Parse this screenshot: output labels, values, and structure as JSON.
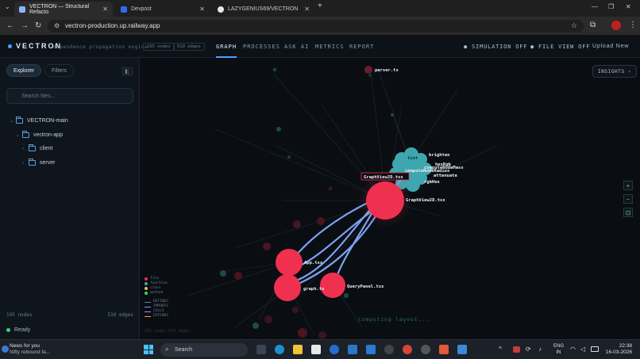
{
  "browser": {
    "tabs": [
      {
        "label": "VECTRON — Structural Refacto",
        "color": "#8ab4f8",
        "active": true
      },
      {
        "label": "Devpost",
        "color": "#2c6bed",
        "active": false
      },
      {
        "label": "LAZYGENIUS69/VECTRON",
        "color": "#e8e8e8",
        "active": false
      }
    ],
    "new_tab": "+",
    "url": "vectron-production.up.railway.app"
  },
  "header": {
    "brand": "VECTRON",
    "tagline": "dependence propagation engine",
    "nodes_pill": "195 nodes",
    "edges_pill": "510 edges",
    "tabs": [
      "GRAPH",
      "PROCESSES",
      "ASK AI",
      "METRICS",
      "REPORT"
    ],
    "active_tab": "GRAPH",
    "simulation": "SIMULATION OFF",
    "file_view": "FILE VIEW OFF",
    "upload": "Upload New"
  },
  "sidebar": {
    "tabs": [
      "Explorer",
      "Filters"
    ],
    "search_placeholder": "Search files...",
    "tree": [
      {
        "label": "VECTRON-main",
        "depth": 0,
        "expanded": true
      },
      {
        "label": "vectron-app",
        "depth": 1,
        "expanded": true
      },
      {
        "label": "client",
        "depth": 2,
        "expanded": false
      },
      {
        "label": "server",
        "depth": 2,
        "expanded": false
      }
    ],
    "node_count": "195 nodes",
    "edge_count": "510 edges",
    "status": "Ready"
  },
  "graph": {
    "insights": "INSIGHTS",
    "computing": "computing layout...",
    "stats_dim": "195 nodes   510 edges",
    "nodes": [
      {
        "label": "GraphView2D.tsx",
        "kind": "file"
      },
      {
        "label": "App.tsx",
        "kind": "file"
      },
      {
        "label": "graph.ts",
        "kind": "file"
      },
      {
        "label": "QueryPanel.tsx",
        "kind": "file"
      },
      {
        "label": "parser.ts",
        "kind": "file"
      }
    ],
    "cluster_labels": [
      "brighten",
      "hexRgb",
      "computeNodeMass",
      "computeNodeRadius",
      "attenuate",
      "rgbHex",
      "tint"
    ],
    "hover_label": "GraphView2D.tsx",
    "colors": {
      "file": "#f0304f",
      "function": "#3ea6ae",
      "edge": "#7da2f0"
    },
    "legend": {
      "nodes": [
        {
          "label": "file",
          "color": "#f0304f"
        },
        {
          "label": "function",
          "color": "#3ea6ae"
        },
        {
          "label": "class",
          "color": "#e6c34a"
        },
        {
          "label": "method",
          "color": "#3fd07a"
        }
      ],
      "edges": [
        {
          "label": "DEFINES",
          "color": "#6b7b8b"
        },
        {
          "label": "IMPORTS",
          "color": "#7da2f0"
        },
        {
          "label": "CALLS",
          "color": "#a98ae8"
        },
        {
          "label": "EXTENDS",
          "color": "#e8a24a"
        }
      ]
    }
  },
  "taskbar": {
    "news_title": "News for you",
    "news_sub": "Nifty rebound fa...",
    "search": "Search",
    "lang1": "ENG",
    "lang2": "IN",
    "time": "22:38",
    "date": "16-03-2026"
  }
}
